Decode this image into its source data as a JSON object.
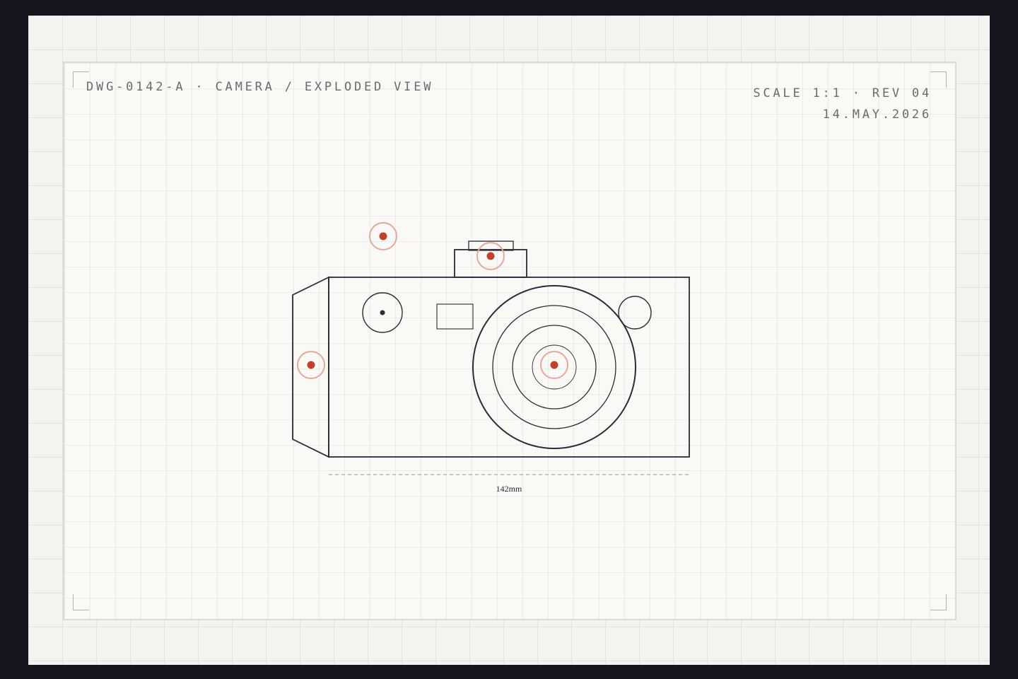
{
  "header": {
    "drawing_id": "DWG-0142-A",
    "separator": "·",
    "subject": "CAMERA / EXPLODED VIEW",
    "scale": "SCALE 1:1",
    "revision": "REV 04",
    "date": "14.MAY.2026"
  },
  "drawing": {
    "dimension_label": "142mm",
    "hotspots": [
      {
        "name": "hotspot-shutter"
      },
      {
        "name": "hotspot-hot-shoe"
      },
      {
        "name": "hotspot-grip"
      },
      {
        "name": "hotspot-lens"
      }
    ]
  },
  "colors": {
    "line": "#2a2b36",
    "accent": "#c0412c",
    "accent_ring": "#e3aa9c",
    "sheet": "#faf9f6",
    "background": "#15151f"
  }
}
